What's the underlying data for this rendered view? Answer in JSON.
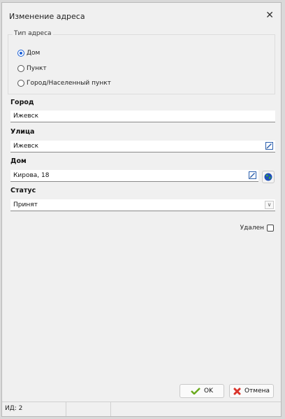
{
  "window": {
    "title": "Изменение адреса",
    "close_glyph": "✕"
  },
  "address_type": {
    "legend": "Тип адреса",
    "options": [
      {
        "label": "Дом",
        "checked": true
      },
      {
        "label": "Пункт",
        "checked": false
      },
      {
        "label": "Город/Населенный пункт",
        "checked": false
      }
    ]
  },
  "city": {
    "label": "Город",
    "value": "Ижевск"
  },
  "street": {
    "label": "Улица",
    "value": "Ижевск"
  },
  "house": {
    "label": "Дом",
    "value": "Кирова, 18"
  },
  "status": {
    "label": "Статус",
    "value": "Принят"
  },
  "deleted": {
    "label": "Удален",
    "checked": false
  },
  "buttons": {
    "ok": "OK",
    "cancel": "Отмена"
  },
  "statusbar": {
    "id_text": "ИД: 2"
  },
  "colors": {
    "accent": "#1a5fd6",
    "ok_green": "#6aaa1e",
    "cancel_red": "#d9342b"
  }
}
